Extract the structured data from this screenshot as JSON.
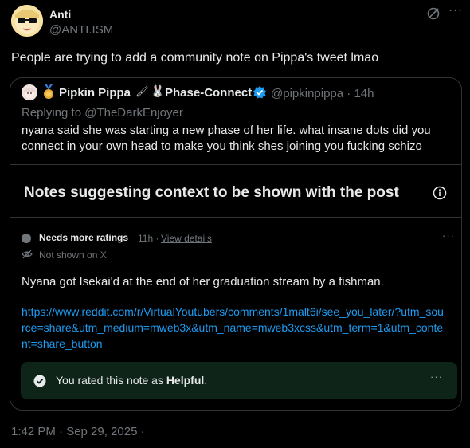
{
  "post": {
    "author_name": "Anti",
    "author_handle": "@ANTI.ISM",
    "text": "People are trying to add a community note on Pippa's tweet lmao",
    "timestamp": "1:42 PM · Sep 29, 2025 ·",
    "more_label": "···"
  },
  "quote": {
    "name": "Pipkin Pippa",
    "brush_emoji": "🖌",
    "bunny_emoji": "🐰",
    "name_suffix": "Phase-Connect",
    "handle_time": "@pipkinpippa · 14h",
    "replying_to": "Replying to @TheDarkEnjoyer",
    "text": "nyana said she was starting a new phase of her life. what insane dots did you connect in your own head to make you think shes joining you fucking schizo"
  },
  "notes": {
    "header": "Notes suggesting context to be shown with the post",
    "status": "Needs more ratings",
    "time": "11h ·",
    "view_details": "View details",
    "not_shown": "Not shown on X",
    "body": "Nyana got Isekai'd at the end of her graduation stream by a fishman.",
    "url": "https://www.reddit.com/r/VirtualYoutubers/comments/1malt6i/see_you_later/?utm_source=share&utm_medium=mweb3x&utm_name=mweb3xcss&utm_term=1&utm_content=share_button",
    "rated_prefix": "You rated this note as ",
    "rated_value": "Helpful",
    "rated_suffix": ".",
    "more_label": "···"
  },
  "colors": {
    "background": "#000000",
    "accent": "#1d9bf0",
    "rated_bg": "#0f2418"
  },
  "icons": [
    "grok-icon",
    "info-icon",
    "eye-slash-icon",
    "check-circle-icon",
    "verified-badge-icon",
    "medal-icon"
  ]
}
